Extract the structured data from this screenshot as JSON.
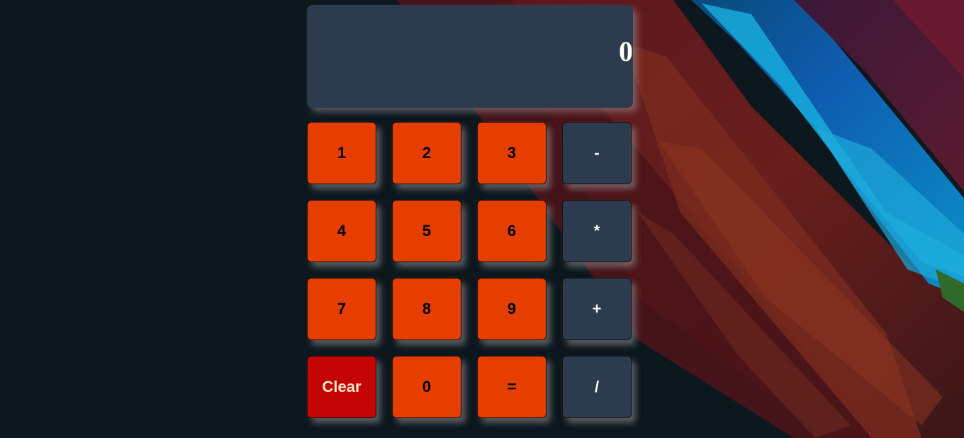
{
  "calculator": {
    "display_value": "0",
    "keys": {
      "one": "1",
      "two": "2",
      "three": "3",
      "minus": "-",
      "four": "4",
      "five": "5",
      "six": "6",
      "multiply": "*",
      "seven": "7",
      "eight": "8",
      "nine": "9",
      "plus": "+",
      "clear": "Clear",
      "zero": "0",
      "equals": "=",
      "divide": "/"
    }
  },
  "colors": {
    "page_background": "#0d171e",
    "display_background": "#2d3b4f",
    "number_key": "#e63e00",
    "operator_key": "#2d3b4f",
    "clear_key": "#c40505"
  }
}
